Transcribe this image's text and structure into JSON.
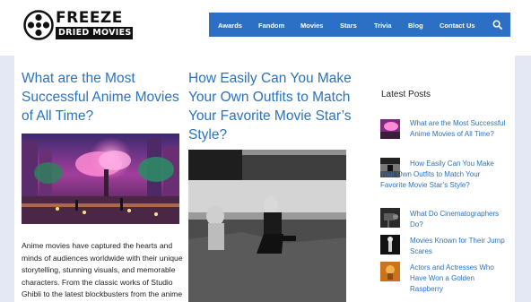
{
  "brand": {
    "name_line1": "FREEZE",
    "name_line2": "DRIED MOVIES"
  },
  "nav": {
    "items": [
      "Awards",
      "Fandom",
      "Movies",
      "Stars",
      "Trivia",
      "Blog",
      "Contact Us"
    ],
    "search_icon": "search-icon",
    "color": "#2b70c4"
  },
  "posts": [
    {
      "title": "What are the Most Successful Anime Movies of All Time?",
      "excerpt": "Anime movies have captured the hearts and minds of audiences worldwide with their unique storytelling, stunning visuals, and memorable characters. From the classic works of Studio Ghibli to the latest blockbusters from the anime"
    },
    {
      "title": "How Easily Can You Make Your Own Outfits to Match Your Favorite Movie Star’s Style?"
    }
  ],
  "sidebar": {
    "title": "Latest Posts",
    "items": [
      {
        "label": "What are the Most Successful Anime Movies of All Time?"
      },
      {
        "label": "How Easily Can You Make Your Own Outfits to Match Your Favorite Movie Star’s Style?"
      },
      {
        "label": "What Do Cinematographers Do?"
      },
      {
        "label": "Movies Known for Their Jump Scares"
      },
      {
        "label": "Actors and Actresses Who Have Won a Golden Raspberry"
      }
    ]
  },
  "colors": {
    "link": "#2b72bf",
    "page_bg": "#e3e8f4"
  }
}
